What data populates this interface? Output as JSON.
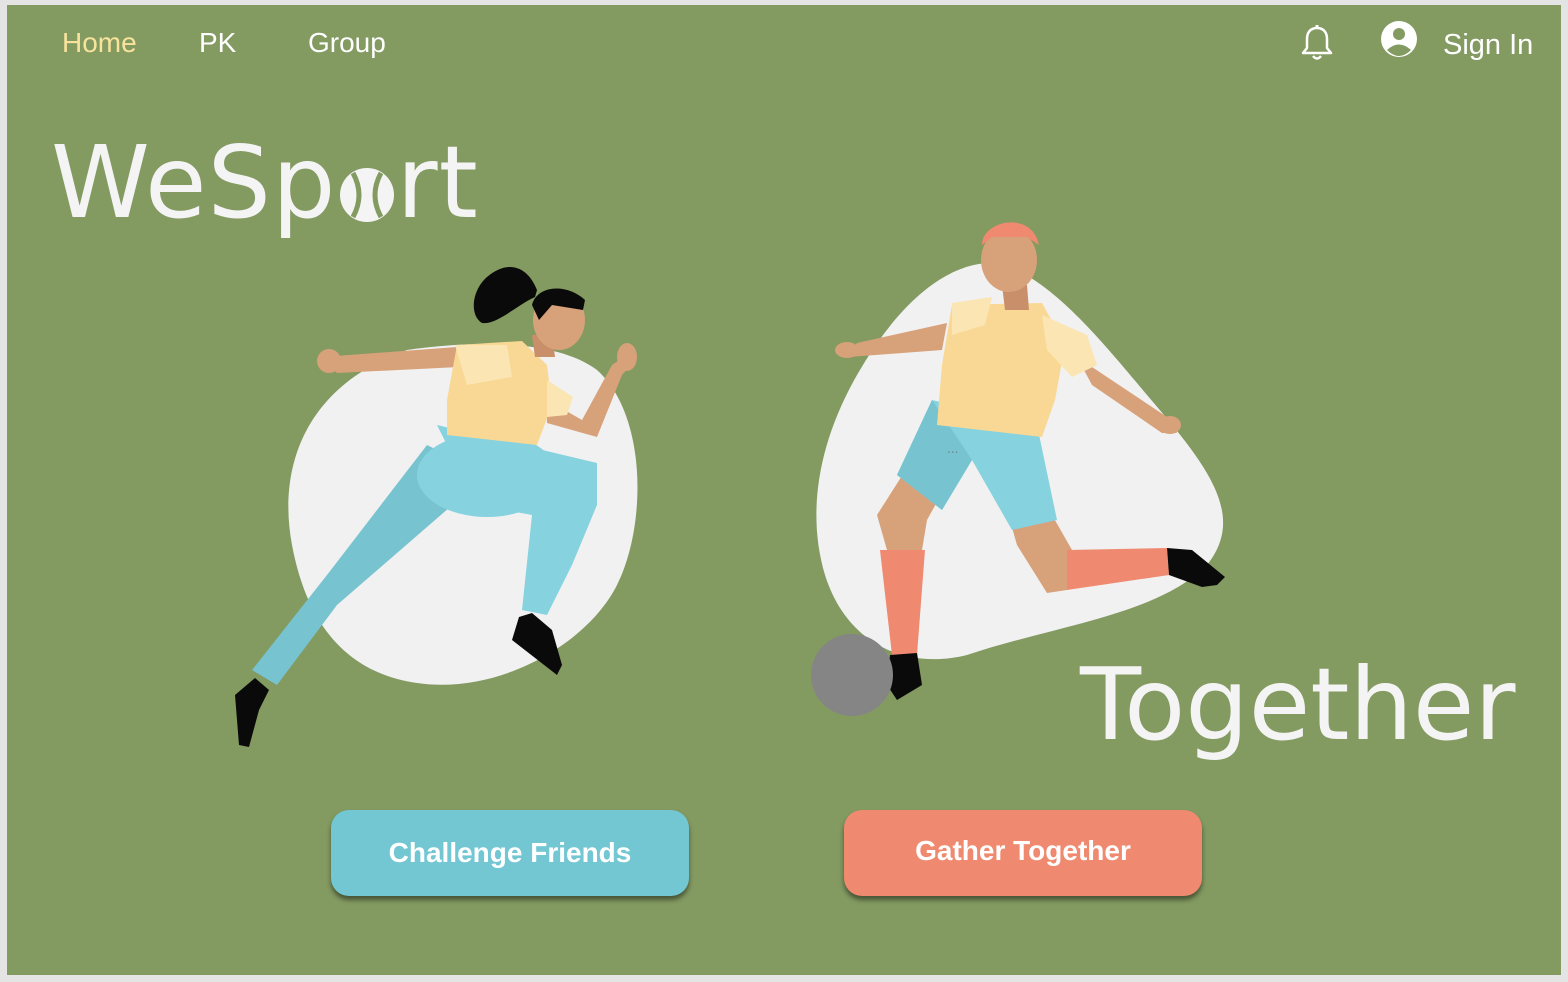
{
  "nav": {
    "items": [
      {
        "label": "Home",
        "active": true
      },
      {
        "label": "PK",
        "active": false
      },
      {
        "label": "Group",
        "active": false
      }
    ],
    "notification_icon": "bell-icon",
    "account_icon": "user-circle-icon",
    "sign_in_label": "Sign In"
  },
  "hero": {
    "logo_prefix": "WeSp",
    "logo_suffix": "rt",
    "logo_o_icon": "tennis-ball-icon",
    "tagline": "Together"
  },
  "actions": {
    "challenge_label": "Challenge Friends",
    "gather_label": "Gather Together"
  },
  "colors": {
    "background": "#839a61",
    "nav_active": "#f7e39c",
    "challenge_button": "#73c7d3",
    "gather_button": "#ef8a70",
    "blob": "#f1f1f1"
  }
}
